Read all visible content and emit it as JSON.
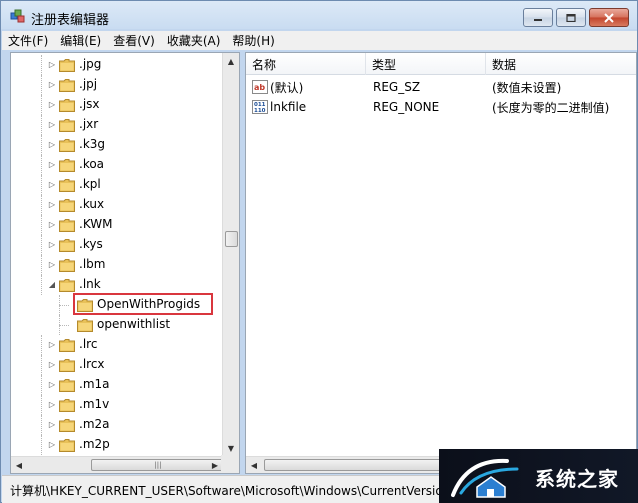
{
  "window": {
    "title": "注册表编辑器",
    "minimize_icon": "minimize-icon",
    "maximize_icon": "maximize-icon",
    "close_icon": "close-icon"
  },
  "menu": [
    "文件(F)",
    "编辑(E)",
    "查看(V)",
    "收藏夹(A)",
    "帮助(H)"
  ],
  "tree": {
    "items": [
      {
        "label": ".jpg",
        "expander": "collapsed"
      },
      {
        "label": ".jpj",
        "expander": "collapsed"
      },
      {
        "label": ".jsx",
        "expander": "collapsed"
      },
      {
        "label": ".jxr",
        "expander": "collapsed"
      },
      {
        "label": ".k3g",
        "expander": "collapsed"
      },
      {
        "label": ".koa",
        "expander": "collapsed"
      },
      {
        "label": ".kpl",
        "expander": "collapsed"
      },
      {
        "label": ".kux",
        "expander": "collapsed"
      },
      {
        "label": ".KWM",
        "expander": "collapsed"
      },
      {
        "label": ".kys",
        "expander": "collapsed"
      },
      {
        "label": ".lbm",
        "expander": "collapsed"
      },
      {
        "label": ".lnk",
        "expander": "expanded"
      },
      {
        "label": "OpenWithProgids",
        "expander": "none",
        "selected": true
      },
      {
        "label": "openwithlist",
        "expander": "none"
      },
      {
        "label": ".lrc",
        "expander": "collapsed"
      },
      {
        "label": ".lrcx",
        "expander": "collapsed"
      },
      {
        "label": ".m1a",
        "expander": "collapsed"
      },
      {
        "label": ".m1v",
        "expander": "collapsed"
      },
      {
        "label": ".m2a",
        "expander": "collapsed"
      },
      {
        "label": ".m2p",
        "expander": "collapsed"
      }
    ]
  },
  "list": {
    "columns": [
      "名称",
      "类型",
      "数据"
    ],
    "rows": [
      {
        "name": "(默认)",
        "type": "REG_SZ",
        "data": "(数值未设置)",
        "icon": "string-value-icon"
      },
      {
        "name": "lnkfile",
        "type": "REG_NONE",
        "data": "(长度为零的二进制值)",
        "icon": "binary-value-icon"
      }
    ]
  },
  "status": {
    "path": "计算机\\HKEY_CURRENT_USER\\Software\\Microsoft\\Windows\\CurrentVersion\\Explorer\\FileExts\\.lnk\\OpenWithProgids"
  },
  "watermark": {
    "text": "系统之家"
  },
  "colors": {
    "selection_border": "#d9363e",
    "folder": "#e8c15a"
  }
}
